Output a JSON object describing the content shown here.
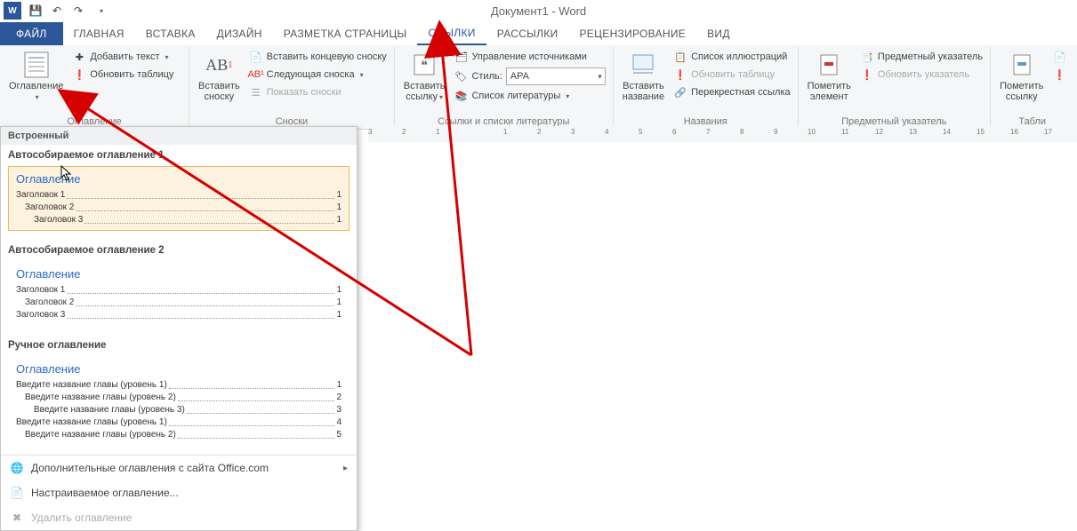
{
  "title": "Документ1 - Word",
  "qat": {
    "save": "💾",
    "undo": "↶",
    "redo": "↷"
  },
  "tabs": {
    "file": "ФАЙЛ",
    "home": "ГЛАВНАЯ",
    "insert": "ВСТАВКА",
    "design": "ДИЗАЙН",
    "layout": "РАЗМЕТКА СТРАНИЦЫ",
    "references": "ССЫЛКИ",
    "mailings": "РАССЫЛКИ",
    "review": "РЕЦЕНЗИРОВАНИЕ",
    "view": "ВИД"
  },
  "ribbon": {
    "toc": {
      "btn": "Оглавление",
      "add_text": "Добавить текст",
      "update": "Обновить таблицу",
      "group": "Оглавление"
    },
    "footnotes": {
      "insert": "Вставить\nсноску",
      "ab": "AB¹",
      "end": "Вставить концевую сноску",
      "next": "Следующая сноска",
      "show": "Показать сноски",
      "group": "Сноски"
    },
    "citations": {
      "insert": "Вставить\nссылку",
      "manage": "Управление источниками",
      "style_lbl": "Стиль:",
      "style_val": "APA",
      "biblio": "Список литературы",
      "group": "Ссылки и списки литературы"
    },
    "captions": {
      "insert": "Вставить\nназвание",
      "illus": "Список иллюстраций",
      "update": "Обновить таблицу",
      "cross": "Перекрестная ссылка",
      "group": "Названия"
    },
    "index": {
      "mark": "Пометить\nэлемент",
      "subject": "Предметный указатель",
      "update": "Обновить указатель",
      "group": "Предметный указатель"
    },
    "authorities": {
      "mark": "Пометить\nссылку",
      "group": "Табли"
    }
  },
  "gallery": {
    "builtin": "Встроенный",
    "auto1": "Автособираемое оглавление 1",
    "auto2": "Автособираемое оглавление 2",
    "manual": "Ручное оглавление",
    "toc_title": "Оглавление",
    "h1": "Заголовок 1",
    "h2": "Заголовок 2",
    "h3": "Заголовок 3",
    "m1": "Введите название главы (уровень 1)",
    "m2": "Введите название главы (уровень 2)",
    "m3": "Введите название главы (уровень 3)",
    "p1": "1",
    "p2": "2",
    "p3": "3",
    "p4": "4",
    "p5": "5",
    "more": "Дополнительные оглавления с сайта Office.com",
    "custom": "Настраиваемое оглавление...",
    "remove": "Удалить оглавление"
  },
  "ruler": {
    "marks": [
      "3",
      "2",
      "1",
      "",
      "1",
      "2",
      "3",
      "4",
      "5",
      "6",
      "7",
      "8",
      "9",
      "10",
      "11",
      "12",
      "13",
      "14",
      "15",
      "16",
      "17"
    ]
  }
}
